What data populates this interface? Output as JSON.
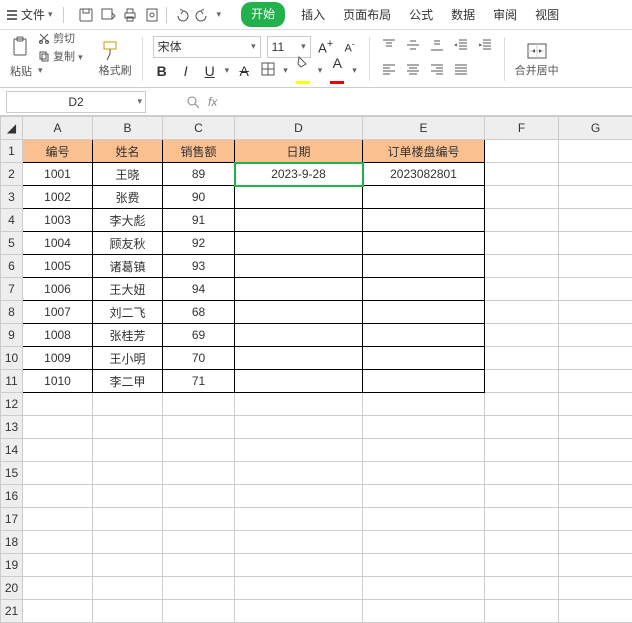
{
  "menu": {
    "file": "文件",
    "tabs": [
      "开始",
      "插入",
      "页面布局",
      "公式",
      "数据",
      "审阅",
      "视图"
    ],
    "active_tab": 0
  },
  "clipboard": {
    "paste": "粘贴",
    "cut": "剪切",
    "copy": "复制",
    "fmt": "格式刷"
  },
  "font": {
    "name": "宋体",
    "size": "11"
  },
  "merge": {
    "label": "合并居中"
  },
  "namebox": "D2",
  "fx_label": "fx",
  "columns": [
    "A",
    "B",
    "C",
    "D",
    "E",
    "F",
    "G"
  ],
  "headers": {
    "A": "编号",
    "B": "姓名",
    "C": "销售额",
    "D": "日期",
    "E": "订单楼盘编号"
  },
  "rows": [
    {
      "A": "1001",
      "B": "王晓",
      "C": "89",
      "D": "2023-9-28",
      "E": "2023082801"
    },
    {
      "A": "1002",
      "B": "张费",
      "C": "90",
      "D": "",
      "E": ""
    },
    {
      "A": "1003",
      "B": "李大彪",
      "C": "91",
      "D": "",
      "E": ""
    },
    {
      "A": "1004",
      "B": "顾友秋",
      "C": "92",
      "D": "",
      "E": ""
    },
    {
      "A": "1005",
      "B": "诸葛镇",
      "C": "93",
      "D": "",
      "E": ""
    },
    {
      "A": "1006",
      "B": "王大妞",
      "C": "94",
      "D": "",
      "E": ""
    },
    {
      "A": "1007",
      "B": "刘二飞",
      "C": "68",
      "D": "",
      "E": ""
    },
    {
      "A": "1008",
      "B": "张桂芳",
      "C": "69",
      "D": "",
      "E": ""
    },
    {
      "A": "1009",
      "B": "王小明",
      "C": "70",
      "D": "",
      "E": ""
    },
    {
      "A": "1010",
      "B": "李二甲",
      "C": "71",
      "D": "",
      "E": ""
    }
  ],
  "selected_cell": "D2"
}
